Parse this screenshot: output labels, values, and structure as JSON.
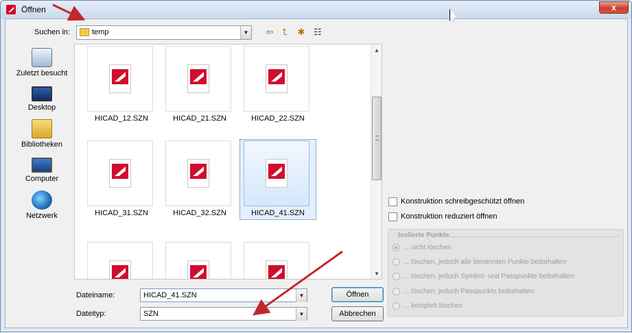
{
  "window": {
    "title": "Öffnen",
    "close_label": "x"
  },
  "lookin": {
    "label": "Suchen in:",
    "value": "temp"
  },
  "toolbar": {
    "back_icon": "back-arrow-icon",
    "up_icon": "folder-up-icon",
    "new_folder_icon": "new-folder-icon",
    "views_icon": "view-menu-icon"
  },
  "places": [
    {
      "label": "Zuletzt besucht",
      "icon": "recent-places-icon"
    },
    {
      "label": "Desktop",
      "icon": "desktop-icon"
    },
    {
      "label": "Bibliotheken",
      "icon": "libraries-icon"
    },
    {
      "label": "Computer",
      "icon": "computer-icon"
    },
    {
      "label": "Netzwerk",
      "icon": "network-icon"
    }
  ],
  "files": [
    {
      "name": "HICAD_12.SZN",
      "selected": false
    },
    {
      "name": "HICAD_21.SZN",
      "selected": false
    },
    {
      "name": "HICAD_22.SZN",
      "selected": false
    },
    {
      "name": "HICAD_31.SZN",
      "selected": false
    },
    {
      "name": "HICAD_32.SZN",
      "selected": false
    },
    {
      "name": "HICAD_41.SZN",
      "selected": true
    },
    {
      "name": "",
      "selected": false
    },
    {
      "name": "",
      "selected": false
    },
    {
      "name": "",
      "selected": false
    }
  ],
  "filename": {
    "label": "Dateiname:",
    "value": "HICAD_41.SZN"
  },
  "filetype": {
    "label": "Dateityp:",
    "value": "SZN"
  },
  "buttons": {
    "open": "Öffnen",
    "cancel": "Abbrechen"
  },
  "options": {
    "readonly": "Konstruktion schreibgeschützt öffnen",
    "reduced": "Konstruktion reduziert öffnen"
  },
  "isolated_points": {
    "title": "Isolierte Punkte",
    "options": [
      "... nicht löschen",
      "... löschen, jedoch alle benannten Punkte beibehalten",
      "... löschen, jedoch Symbol- und Passpunkte beibehalten",
      "... löschen, jedoch Passpunkte beibehalten",
      "... komplett löschen"
    ],
    "selected_index": 0
  },
  "colors": {
    "accent": "#d10d2c",
    "annotation_arrow": "#c0282a",
    "selection": "#cce1fb"
  }
}
